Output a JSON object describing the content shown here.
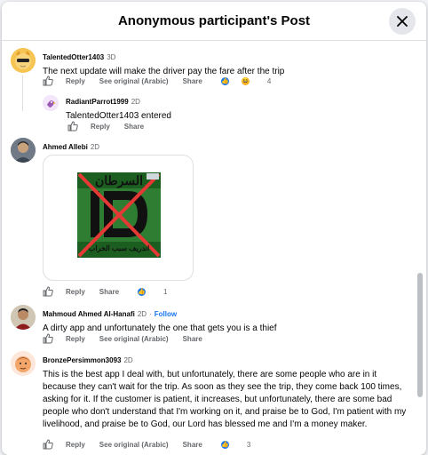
{
  "header": {
    "title": "Anonymous participant's Post"
  },
  "actions": {
    "reply": "Reply",
    "see_original": "See original (Arabic)",
    "share": "Share"
  },
  "comments": [
    {
      "name": "TalentedOtter1403",
      "time": "3D",
      "text": "The next update will make the driver pay the fare after the trip",
      "reaction_count": "4"
    },
    {
      "name": "RadiantParrot1999",
      "time": "2D",
      "text": "TalentedOtter1403 entered"
    },
    {
      "name": "Ahmed Allebi",
      "time": "2D",
      "image_text_top": "السرطان",
      "image_text_bottom": "اندريف سبب الخراب",
      "reaction_count": "1"
    },
    {
      "name": "Mahmoud Ahmed Al-Hanafi",
      "time": "2D",
      "follow": "Follow",
      "text": "A dirty app and unfortunately the one that gets you is a thief"
    },
    {
      "name": "BronzePersimmon3093",
      "time": "2D",
      "text": "This is the best app I deal with, but unfortunately, there are some people who are in it because they can't wait for the trip. As soon as they see the trip, they come back 100 times, asking for it. If the customer is patient, it increases, but unfortunately, there are some bad people who don't understand that I'm working on it, and praise be to God, I'm patient with my livelihood, and praise be to God, our Lord has blessed me and I'm a money maker.",
      "reaction_count": "3"
    }
  ],
  "colors": {
    "accent": "#1877f2",
    "secondary_text": "#65676b",
    "image_bg": "#2e7d32",
    "cross": "#e53935"
  }
}
